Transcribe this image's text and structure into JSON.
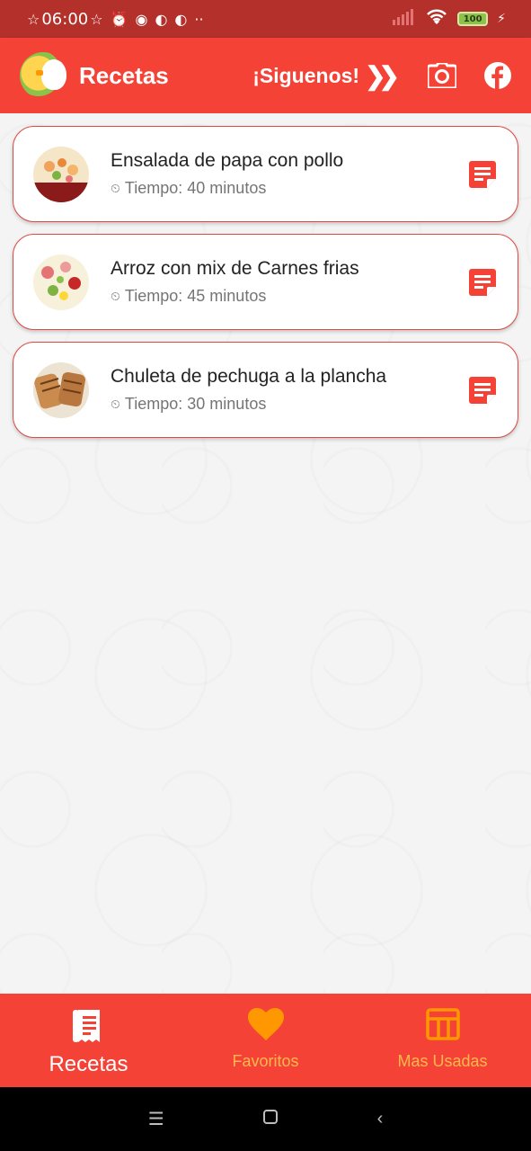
{
  "status_bar": {
    "time": "06:00",
    "battery": "100"
  },
  "app_bar": {
    "title": "Recetas",
    "follow_label": "¡Siguenos!",
    "chevrons": "❯❯"
  },
  "recipes": [
    {
      "title": "Ensalada de papa con pollo",
      "time": "Tiempo: 40 minutos"
    },
    {
      "title": "Arroz con mix de Carnes frias",
      "time": "Tiempo: 45 minutos"
    },
    {
      "title": "Chuleta de pechuga a la plancha",
      "time": "Tiempo: 30 minutos"
    }
  ],
  "bottom_nav": {
    "items": [
      {
        "label": "Recetas",
        "icon": "receipt-icon",
        "active": true
      },
      {
        "label": "Favoritos",
        "icon": "heart-icon",
        "active": false
      },
      {
        "label": "Mas Usadas",
        "icon": "table-icon",
        "active": false
      }
    ]
  },
  "colors": {
    "primary": "#f44336",
    "status_bar": "#b3302b",
    "inactive_nav": "#ffb74d",
    "card_border": "#d94b44"
  }
}
